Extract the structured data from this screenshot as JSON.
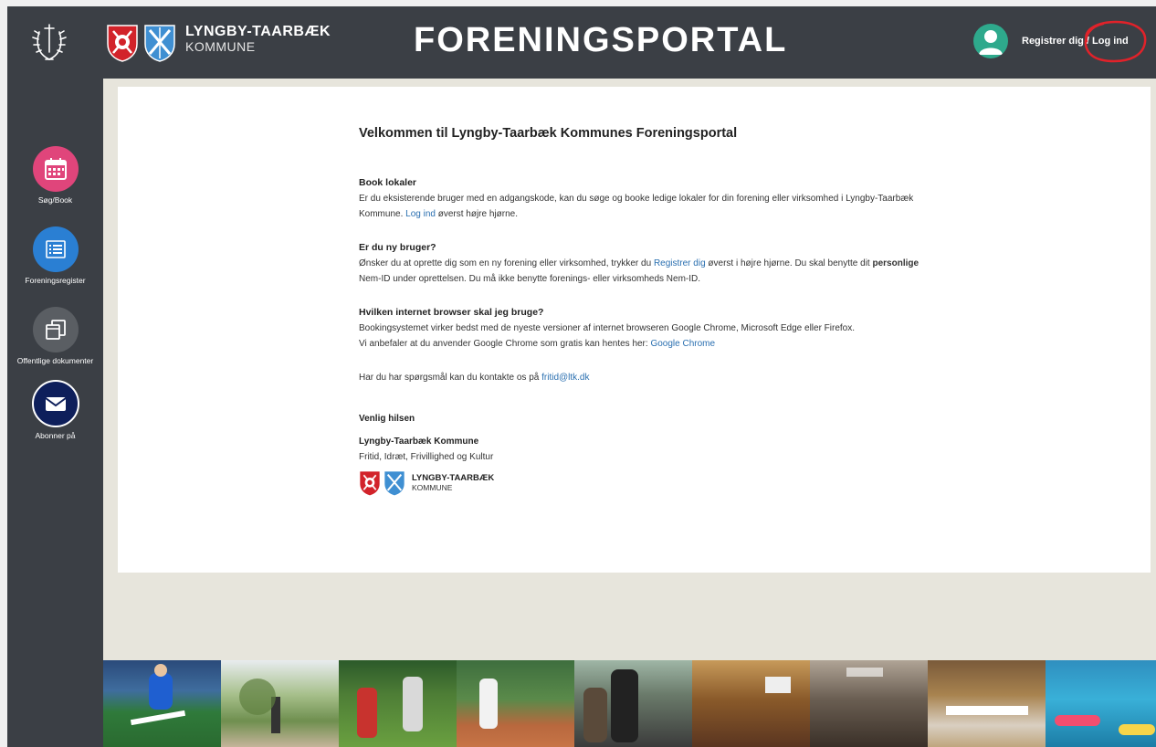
{
  "header": {
    "kommune_line1": "LYNGBY-TAARBÆK",
    "kommune_line2": "KOMMUNE",
    "portal_title": "FORENINGSPORTAL",
    "register_label": "Registrer dig",
    "separator": " / ",
    "login_label": "Log ind"
  },
  "sidebar": {
    "items": [
      {
        "label": "Søg/Book",
        "icon": "calendar-icon",
        "color": "#e0457b"
      },
      {
        "label": "Foreningsregister",
        "icon": "list-icon",
        "color": "#2a7fd3"
      },
      {
        "label": "Offentlige dokumenter",
        "icon": "documents-icon",
        "color": "#5a5e63"
      },
      {
        "label": "Abonner på",
        "icon": "envelope-icon",
        "color": "#0e1f5b"
      }
    ]
  },
  "main": {
    "title": "Velkommen til Lyngby-Taarbæk Kommunes Foreningsportal",
    "book": {
      "heading": "Book lokaler",
      "text1": "Er du eksisterende bruger med en adgangskode, kan du søge og booke ledige lokaler for din forening eller virksomhed i Lyngby-Taarbæk Kommune.",
      "link": "Log ind",
      "text2": " øverst højre hjørne."
    },
    "new_user": {
      "heading": "Er du ny bruger?",
      "text1": "Ønsker du at oprette dig som en ny forening eller virksomhed, trykker du ",
      "link": "Registrer dig",
      "text2": " øverst i højre hjørne. Du skal benytte dit ",
      "bold": "personlige",
      "text3": " Nem-ID under oprettelsen. Du må ikke benytte forenings- eller virksomheds Nem-ID."
    },
    "browser": {
      "heading": "Hvilken internet browser skal jeg bruge?",
      "text1": "Bookingsystemet virker bedst med de nyeste versioner af internet browseren Google Chrome, Microsoft Edge eller Firefox.",
      "text2": "Vi anbefaler at du anvender Google Chrome som gratis kan hentes her: ",
      "link": "Google Chrome"
    },
    "contact": {
      "text": "Har du har spørgsmål kan du kontakte os på ",
      "email": "fritid@ltk.dk"
    },
    "signoff": {
      "greeting": "Venlig hilsen",
      "org": "Lyngby-Taarbæk Kommune",
      "dept": "Fritid, Idræt, Frivillighed og Kultur",
      "logo_line1": "LYNGBY-TAARBÆK",
      "logo_line2": "KOMMUNE"
    }
  },
  "photo_strip": [
    "football",
    "athletics",
    "archery",
    "tennis",
    "gym-crowd",
    "conference-hall",
    "event-hall",
    "meeting-room",
    "swimming-pool"
  ],
  "colors": {
    "bar": "#3b3f45",
    "page_bg": "#e7e5dc",
    "avatar": "#2ea98c",
    "link": "#2a6fb0",
    "highlight": "#e0222a"
  }
}
